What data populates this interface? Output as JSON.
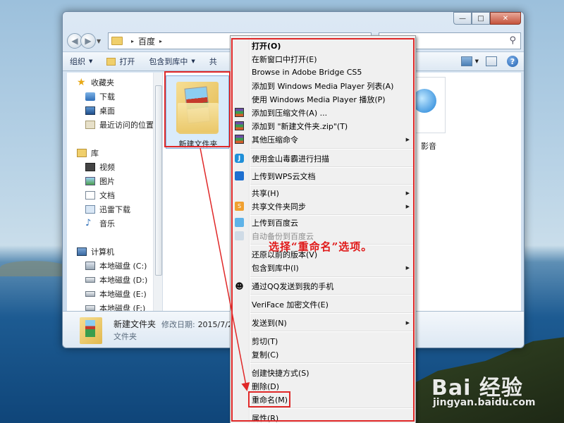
{
  "window": {
    "caption_buttons": [
      "—",
      "□",
      "✕"
    ],
    "address": {
      "sep1": "▸",
      "folder": "百度",
      "sep2": "▸"
    },
    "toolbar": {
      "organize": "组织",
      "open": "打开",
      "include_in_library": "包含到库中",
      "partial_share": "共"
    },
    "sidebar": {
      "favorites": "收藏夹",
      "downloads": "下载",
      "desktop": "桌面",
      "recent_places": "最近访问的位置",
      "libraries": "库",
      "videos": "视频",
      "pictures": "图片",
      "documents": "文档",
      "xunlei_downloads": "迅雷下载",
      "music": "音乐",
      "computer": "计算机",
      "drive_c": "本地磁盘 (C:)",
      "drive_d": "本地磁盘 (D:)",
      "drive_e": "本地磁盘 (E:)",
      "drive_f": "本地磁盘 (F:)"
    },
    "content": {
      "folder_name": "新建文件夹",
      "partial_item_label": "影音"
    },
    "details": {
      "name": "新建文件夹",
      "modified_label": "修改日期:",
      "modified_value": "2015/7/20",
      "type": "文件夹"
    }
  },
  "context_menu": {
    "open": "打开(O)",
    "open_new_window": "在新窗口中打开(E)",
    "browse_bridge": "Browse in Adobe Bridge CS5",
    "add_wmp_list": "添加到 Windows Media Player 列表(A)",
    "play_wmp": "使用 Windows Media Player 播放(P)",
    "add_archive": "添加到压缩文件(A) ...",
    "add_zip": "添加到 \"新建文件夹.zip\"(T)",
    "other_compress": "其他压缩命令",
    "jinshan_scan": "使用金山毒霸进行扫描",
    "upload_wps": "上传到WPS云文档",
    "share": "共享(H)",
    "share_sync": "共享文件夹同步",
    "upload_baidu": "上传到百度云",
    "auto_backup_baidu": "自动备份到百度云",
    "restore_prev": "还原以前的版本(V)",
    "include_library": "包含到库中(I)",
    "qq_send_phone": "通过QQ发送到我的手机",
    "veriface": "VeriFace 加密文件(E)",
    "send_to": "发送到(N)",
    "cut": "剪切(T)",
    "copy": "复制(C)",
    "create_shortcut": "创建快捷方式(S)",
    "delete": "删除(D)",
    "rename": "重命名(M)",
    "properties": "属性(R)",
    "submenu_arrow": "▶"
  },
  "annotation": {
    "text": "选择“重命名”选项。"
  },
  "watermark": {
    "logo": "Bai  经验",
    "url": "jingyan.baidu.com"
  },
  "colors": {
    "annotation_red": "#e02828",
    "selection_blue": "#d9ebfb"
  },
  "icons": [
    "back-icon",
    "forward-icon",
    "folder-icon",
    "refresh-icon",
    "search-icon",
    "view-icon",
    "help-icon",
    "star-icon",
    "music-note-icon",
    "winrar-icon",
    "jinshan-icon",
    "wps-cloud-icon",
    "baidu-cloud-icon",
    "qq-icon"
  ]
}
